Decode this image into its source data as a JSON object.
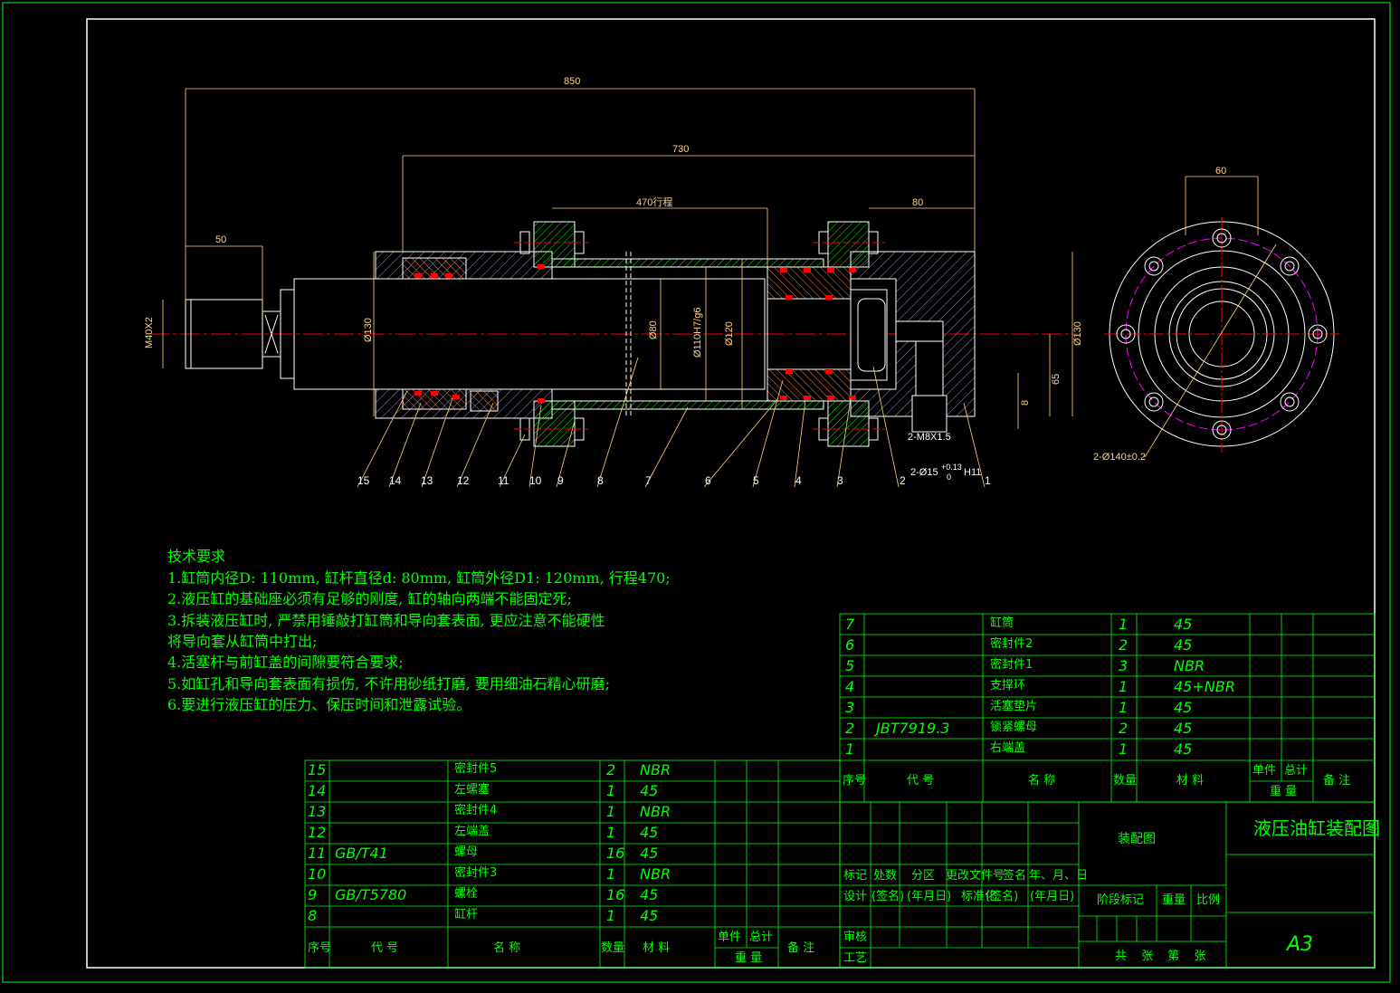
{
  "colors": {
    "frame": "#00ff00",
    "outline": "#ffffff",
    "dimension": "#ffd27f",
    "section": "#ff8040",
    "center": "#ff0000",
    "seal": "#ff0000",
    "bolt": "#a0a0ff",
    "pcd": "#ff00ff"
  },
  "dimensions": {
    "overall": "850",
    "body": "730",
    "stroke": "470行程",
    "flange": "80",
    "thread_len": "50",
    "thread": "M40X2",
    "rod_dia": "Ø130",
    "bore_dia": "Ø80",
    "fit": "Ø110H7/g6",
    "tube_od": "Ø120",
    "body_dia": "Ø130",
    "offset65": "65",
    "offset8": "8",
    "port": "2-M8X1.5",
    "port_dia": "2-Ø15",
    "tol_up": "+0.13",
    "tol_dn": "0",
    "tol_fit": "H11",
    "pcd": "2-Ø140±0.2",
    "side_width": "60"
  },
  "balloons": [
    "15",
    "14",
    "13",
    "12",
    "11",
    "10",
    "9",
    "8",
    "7",
    "6",
    "5",
    "4",
    "3",
    "2",
    "1"
  ],
  "tech": {
    "title": "技术要求",
    "lines": [
      "1.缸筒内径D: 110mm, 缸杆直径d: 80mm, 缸筒外径D1: 120mm, 行程470;",
      "2.液压缸的基础座必须有足够的刚度, 缸的轴向两端不能固定死;",
      "3.拆装液压缸时, 严禁用锤敲打缸筒和导向套表面, 更应注意不能硬性",
      "将导向套从缸筒中打出;",
      "4.活塞杆与前缸盖的间隙要符合要求;",
      "5.如缸孔和导向套表面有损伤, 不许用砂纸打磨, 要用细油石精心研磨;",
      "6.要进行液压缸的压力、保压时间和泄露试验。"
    ]
  },
  "bom_right": [
    {
      "no": "7",
      "code": "",
      "name": "缸筒",
      "qty": "1",
      "mat": "45"
    },
    {
      "no": "6",
      "code": "",
      "name": "密封件2",
      "qty": "2",
      "mat": "45"
    },
    {
      "no": "5",
      "code": "",
      "name": "密封件1",
      "qty": "3",
      "mat": "NBR"
    },
    {
      "no": "4",
      "code": "",
      "name": "支撑环",
      "qty": "1",
      "mat": "45+NBR"
    },
    {
      "no": "3",
      "code": "",
      "name": "活塞垫片",
      "qty": "1",
      "mat": "45"
    },
    {
      "no": "2",
      "code": "JBT7919.3",
      "name": "锁紧螺母",
      "qty": "2",
      "mat": "45"
    },
    {
      "no": "1",
      "code": "",
      "name": "右端盖",
      "qty": "1",
      "mat": "45"
    }
  ],
  "bom_left": [
    {
      "no": "15",
      "code": "",
      "name": "密封件5",
      "qty": "2",
      "mat": "NBR"
    },
    {
      "no": "14",
      "code": "",
      "name": "左螺塞",
      "qty": "1",
      "mat": "45"
    },
    {
      "no": "13",
      "code": "",
      "name": "密封件4",
      "qty": "1",
      "mat": "NBR"
    },
    {
      "no": "12",
      "code": "",
      "name": "左端盖",
      "qty": "1",
      "mat": "45"
    },
    {
      "no": "11",
      "code": "GB/T41",
      "name": "螺母",
      "qty": "16",
      "mat": "45"
    },
    {
      "no": "10",
      "code": "",
      "name": "密封件3",
      "qty": "1",
      "mat": "NBR"
    },
    {
      "no": "9",
      "code": "GB/T5780",
      "name": "螺栓",
      "qty": "16",
      "mat": "45"
    },
    {
      "no": "8",
      "code": "",
      "name": "缸杆",
      "qty": "1",
      "mat": "45"
    }
  ],
  "bom_header": {
    "no": "序号",
    "code": "代 号",
    "name": "名 称",
    "qty": "数量",
    "mat": "材 料",
    "unit": "单件",
    "total": "总计",
    "weight": "重 量",
    "remark": "备 注"
  },
  "title_block": {
    "drawing_kind": "装配图",
    "drawing_title": "液压油缸装配图",
    "sheet": "A3",
    "rev_row": [
      "标记",
      "处数",
      "分区",
      "更改文件号",
      "签名",
      "年、月、日"
    ],
    "sign_row": [
      "设计",
      "(签名)",
      "(年月日)",
      "标准化",
      "(签名)",
      "(年月日)"
    ],
    "check": "审核",
    "process": "工艺",
    "stage": "阶段标记",
    "weight": "重量",
    "scale": "比例",
    "sheets": "共 张 第 张"
  }
}
